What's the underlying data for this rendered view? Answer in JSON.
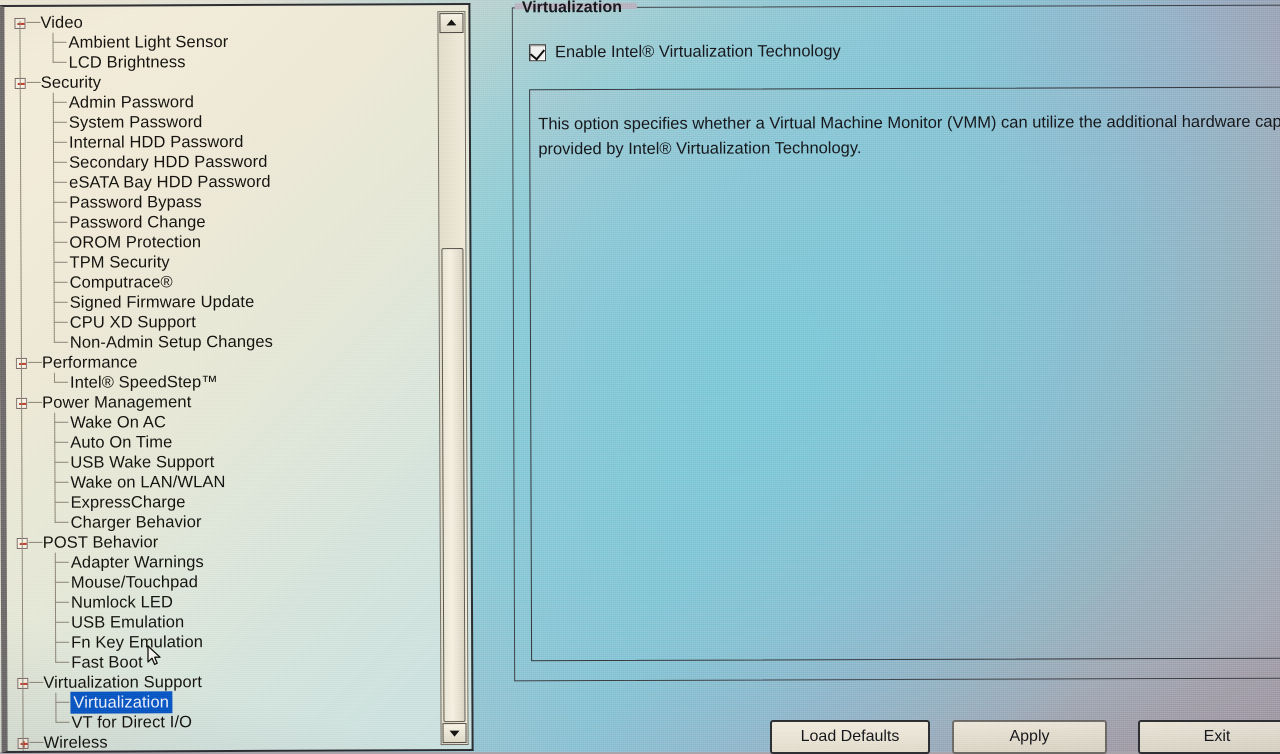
{
  "app": {
    "kind": "bios-setup",
    "selected_item": "Virtualization"
  },
  "colors": {
    "tree_background": "#efe9d6",
    "selection_blue": "#0a56c4",
    "selection_text": "#eef3ff",
    "expander_red": "#c03a2a",
    "panel_gradient_start": "#efe9d8",
    "panel_gradient_mid": "#8cc2d3",
    "panel_gradient_end": "#a6a0ab",
    "text": "#14130f"
  },
  "tree": {
    "name": "bios-settings-tree",
    "items": [
      {
        "label": "Video",
        "depth": 0,
        "expander": "minus",
        "selected": false
      },
      {
        "label": "Ambient Light Sensor",
        "depth": 1,
        "expander": "none",
        "selected": false
      },
      {
        "label": "LCD Brightness",
        "depth": 1,
        "expander": "none",
        "selected": false
      },
      {
        "label": "Security",
        "depth": 0,
        "expander": "minus",
        "selected": false
      },
      {
        "label": "Admin Password",
        "depth": 1,
        "expander": "none",
        "selected": false
      },
      {
        "label": "System Password",
        "depth": 1,
        "expander": "none",
        "selected": false
      },
      {
        "label": "Internal HDD Password",
        "depth": 1,
        "expander": "none",
        "selected": false
      },
      {
        "label": "Secondary HDD Password",
        "depth": 1,
        "expander": "none",
        "selected": false
      },
      {
        "label": "eSATA Bay HDD Password",
        "depth": 1,
        "expander": "none",
        "selected": false
      },
      {
        "label": "Password Bypass",
        "depth": 1,
        "expander": "none",
        "selected": false
      },
      {
        "label": "Password Change",
        "depth": 1,
        "expander": "none",
        "selected": false
      },
      {
        "label": "OROM Protection",
        "depth": 1,
        "expander": "none",
        "selected": false
      },
      {
        "label": "TPM Security",
        "depth": 1,
        "expander": "none",
        "selected": false
      },
      {
        "label": "Computrace®",
        "depth": 1,
        "expander": "none",
        "selected": false
      },
      {
        "label": "Signed Firmware Update",
        "depth": 1,
        "expander": "none",
        "selected": false
      },
      {
        "label": "CPU XD Support",
        "depth": 1,
        "expander": "none",
        "selected": false
      },
      {
        "label": "Non-Admin Setup Changes",
        "depth": 1,
        "expander": "none",
        "selected": false
      },
      {
        "label": "Performance",
        "depth": 0,
        "expander": "minus",
        "selected": false
      },
      {
        "label": "Intel® SpeedStep™",
        "depth": 1,
        "expander": "none",
        "selected": false
      },
      {
        "label": "Power Management",
        "depth": 0,
        "expander": "minus",
        "selected": false
      },
      {
        "label": "Wake On AC",
        "depth": 1,
        "expander": "none",
        "selected": false
      },
      {
        "label": "Auto On Time",
        "depth": 1,
        "expander": "none",
        "selected": false
      },
      {
        "label": "USB Wake Support",
        "depth": 1,
        "expander": "none",
        "selected": false
      },
      {
        "label": "Wake on LAN/WLAN",
        "depth": 1,
        "expander": "none",
        "selected": false
      },
      {
        "label": "ExpressCharge",
        "depth": 1,
        "expander": "none",
        "selected": false
      },
      {
        "label": "Charger Behavior",
        "depth": 1,
        "expander": "none",
        "selected": false
      },
      {
        "label": "POST Behavior",
        "depth": 0,
        "expander": "minus",
        "selected": false
      },
      {
        "label": "Adapter Warnings",
        "depth": 1,
        "expander": "none",
        "selected": false
      },
      {
        "label": "Mouse/Touchpad",
        "depth": 1,
        "expander": "none",
        "selected": false
      },
      {
        "label": "Numlock LED",
        "depth": 1,
        "expander": "none",
        "selected": false
      },
      {
        "label": "USB Emulation",
        "depth": 1,
        "expander": "none",
        "selected": false
      },
      {
        "label": "Fn Key Emulation",
        "depth": 1,
        "expander": "none",
        "selected": false
      },
      {
        "label": "Fast Boot",
        "depth": 1,
        "expander": "none",
        "selected": false
      },
      {
        "label": "Virtualization Support",
        "depth": 0,
        "expander": "minus",
        "selected": false
      },
      {
        "label": "Virtualization",
        "depth": 1,
        "expander": "none",
        "selected": true
      },
      {
        "label": "VT for Direct I/O",
        "depth": 1,
        "expander": "none",
        "selected": false
      },
      {
        "label": "Wireless",
        "depth": 0,
        "expander": "plus",
        "selected": false
      }
    ]
  },
  "scrollbar": {
    "up_arrow": "scroll-up-arrow",
    "down_arrow": "scroll-down-arrow",
    "thumb": "scroll-thumb"
  },
  "detail": {
    "group_title": "Virtualization",
    "checkbox": {
      "label": "Enable Intel® Virtualization Technology",
      "checked": true
    },
    "description": "This option specifies whether a Virtual Machine Monitor (VMM) can utilize the additional hardware capabilities provided by Intel® Virtualization Technology."
  },
  "buttons": {
    "load_defaults": "Load Defaults",
    "apply": "Apply",
    "exit": "Exit"
  }
}
